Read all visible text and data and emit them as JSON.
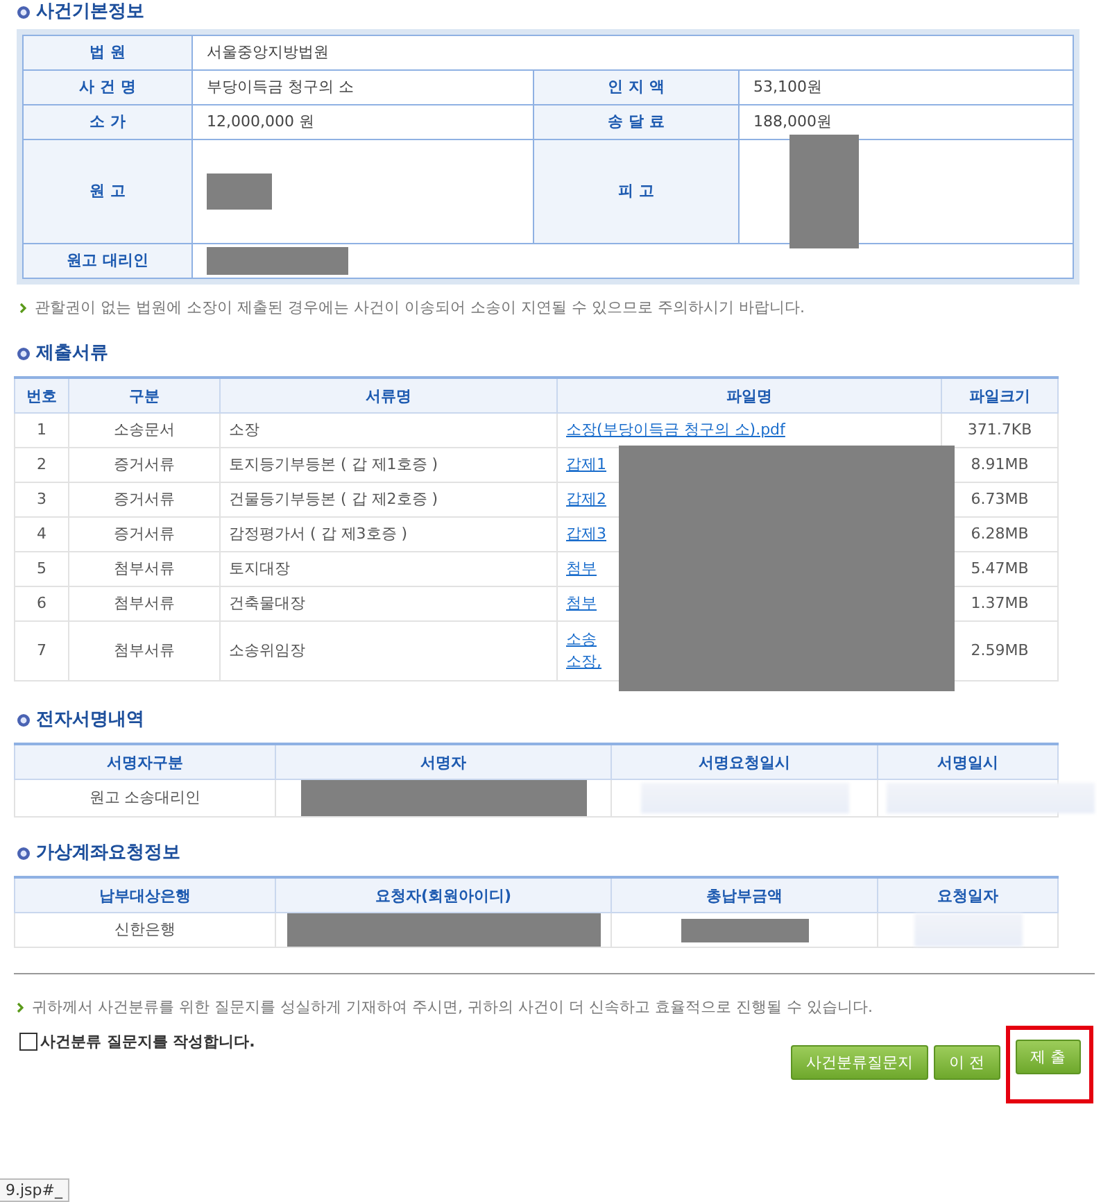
{
  "case_info": {
    "title": "사건기본정보",
    "court": {
      "label": "법 원",
      "value": "서울중앙지방법원"
    },
    "case_name": {
      "label": "사 건 명",
      "value": "부당이득금 청구의 소"
    },
    "stamp_fee": {
      "label": "인 지 액",
      "value": "53,100원"
    },
    "claim_value": {
      "label": "소 가",
      "value": "12,000,000 원"
    },
    "service_fee": {
      "label": "송 달 료",
      "value": "188,000원"
    },
    "plaintiff": {
      "label": "원 고",
      "redacted": true
    },
    "defendant": {
      "label": "피 고",
      "redacted": true
    },
    "attorney": {
      "label": "원고 대리인",
      "redacted": true
    },
    "notice": "관할권이 없는 법원에 소장이 제출된 경우에는 사건이 이송되어 소송이 지연될 수 있으므로 주의하시기 바랍니다."
  },
  "documents": {
    "title": "제출서류",
    "redacted": true,
    "columns": [
      "번호",
      "구분",
      "서류명",
      "파일명",
      "파일크기"
    ],
    "rows": [
      {
        "no": "1",
        "category": "소송문서",
        "name": "소장",
        "file": [
          "소장(부당이득금 청구의 소).pdf"
        ],
        "size": "371.7KB"
      },
      {
        "no": "2",
        "category": "증거서류",
        "name": "토지등기부등본 ( 갑 제1호증 )",
        "file": [
          "갑제1"
        ],
        "size": "8.91MB"
      },
      {
        "no": "3",
        "category": "증거서류",
        "name": "건물등기부등본 ( 갑 제2호증 )",
        "file": [
          "갑제2"
        ],
        "size": "6.73MB"
      },
      {
        "no": "4",
        "category": "증거서류",
        "name": "감정평가서 ( 갑 제3호증 )",
        "file": [
          "갑제3"
        ],
        "size": "6.28MB"
      },
      {
        "no": "5",
        "category": "첨부서류",
        "name": "토지대장",
        "file": [
          "첨부"
        ],
        "size": "5.47MB"
      },
      {
        "no": "6",
        "category": "첨부서류",
        "name": "건축물대장",
        "file": [
          "첨부"
        ],
        "size": "1.37MB"
      },
      {
        "no": "7",
        "category": "첨부서류",
        "name": "소송위임장",
        "file": [
          "소송",
          "소장,"
        ],
        "size": "2.59MB"
      }
    ]
  },
  "signatures": {
    "title": "전자서명내역",
    "columns": [
      "서명자구분",
      "서명자",
      "서명요청일시",
      "서명일시"
    ],
    "rows": [
      {
        "cells": [
          {
            "value": "원고 소송대리인"
          },
          {
            "redacted": true
          },
          {
            "blurred": true
          },
          {
            "blurred": true
          }
        ]
      }
    ]
  },
  "virtual_account": {
    "title": "가상계좌요청정보",
    "columns": [
      "납부대상은행",
      "요청자(회원아이디)",
      "총납부금액",
      "요청일자"
    ],
    "rows": [
      {
        "cells": [
          {
            "value": "신한은행"
          },
          {
            "redacted": true
          },
          {
            "redacted": true
          },
          {
            "blurred": true
          }
        ]
      }
    ]
  },
  "footer": {
    "notice": "귀하께서 사건분류를 위한 질문지를 성실하게 기재하여 주시면, 귀하의 사건이 더 신속하고 효율적으로 진행될 수 있습니다.",
    "questionnaire_checkbox": {
      "label": "사건분류 질문지를 작성합니다.",
      "checked": false
    },
    "buttons": [
      {
        "label": "사건분류질문지",
        "highlighted": false
      },
      {
        "label": "이 전",
        "highlighted": false
      },
      {
        "label": "제 출",
        "highlighted": true
      }
    ]
  },
  "status_bar": {
    "url": "9.jsp#_"
  }
}
